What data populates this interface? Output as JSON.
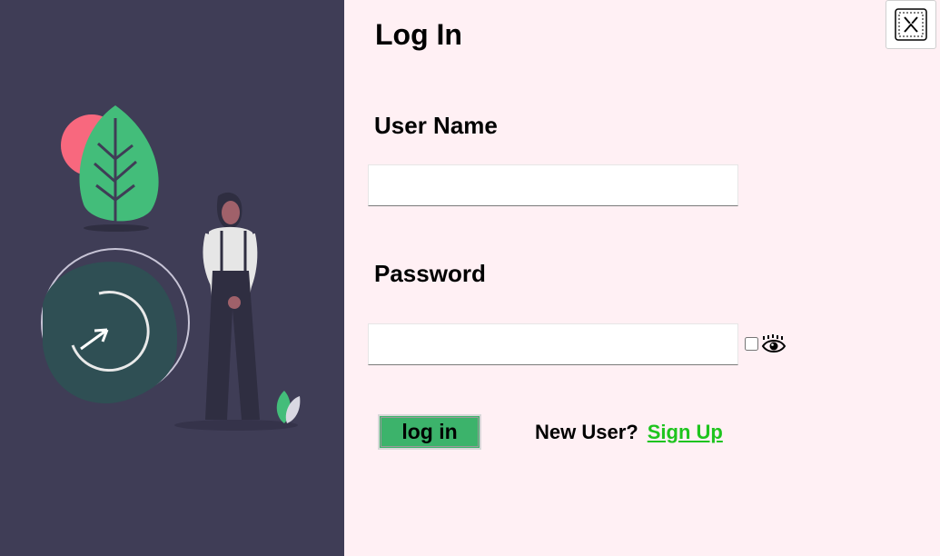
{
  "form": {
    "title": "Log In",
    "username_label": "User Name",
    "username_value": "",
    "password_label": "Password",
    "password_value": "",
    "show_password_checked": false,
    "login_button": "log in",
    "new_user_text": "New User?",
    "signup_link": "Sign Up"
  },
  "icons": {
    "close": "close-icon",
    "eye": "eye-icon"
  },
  "colors": {
    "left_panel": "#3f3d56",
    "page_background": "#fff0f4",
    "login_button": "#3cb36b",
    "signup_link": "#1ec41e"
  }
}
